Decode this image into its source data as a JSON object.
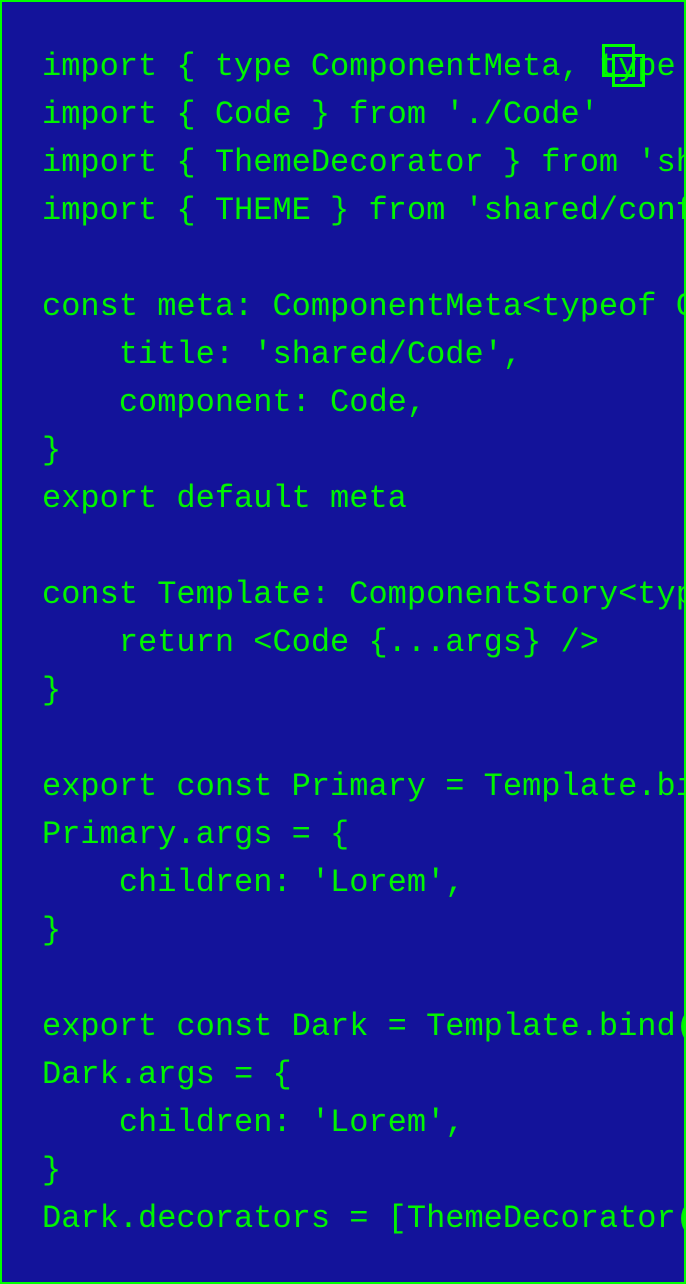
{
  "colors": {
    "background": "#13139a",
    "text": "#00f400",
    "border": "#00ff00"
  },
  "copy_button": {
    "icon": "copy-icon"
  },
  "code_lines": [
    "import { type ComponentMeta, type",
    "import { Code } from './Code'",
    "import { ThemeDecorator } from 'sh",
    "import { THEME } from 'shared/conf",
    "",
    "const meta: ComponentMeta<typeof C",
    "    title: 'shared/Code',",
    "    component: Code,",
    "}",
    "export default meta",
    "",
    "const Template: ComponentStory<typ",
    "    return <Code {...args} />",
    "}",
    "",
    "export const Primary = Template.bi",
    "Primary.args = {",
    "    children: 'Lorem',",
    "}",
    "",
    "export const Dark = Template.bind(",
    "Dark.args = {",
    "    children: 'Lorem',",
    "}",
    "Dark.decorators = [ThemeDecorator("
  ]
}
